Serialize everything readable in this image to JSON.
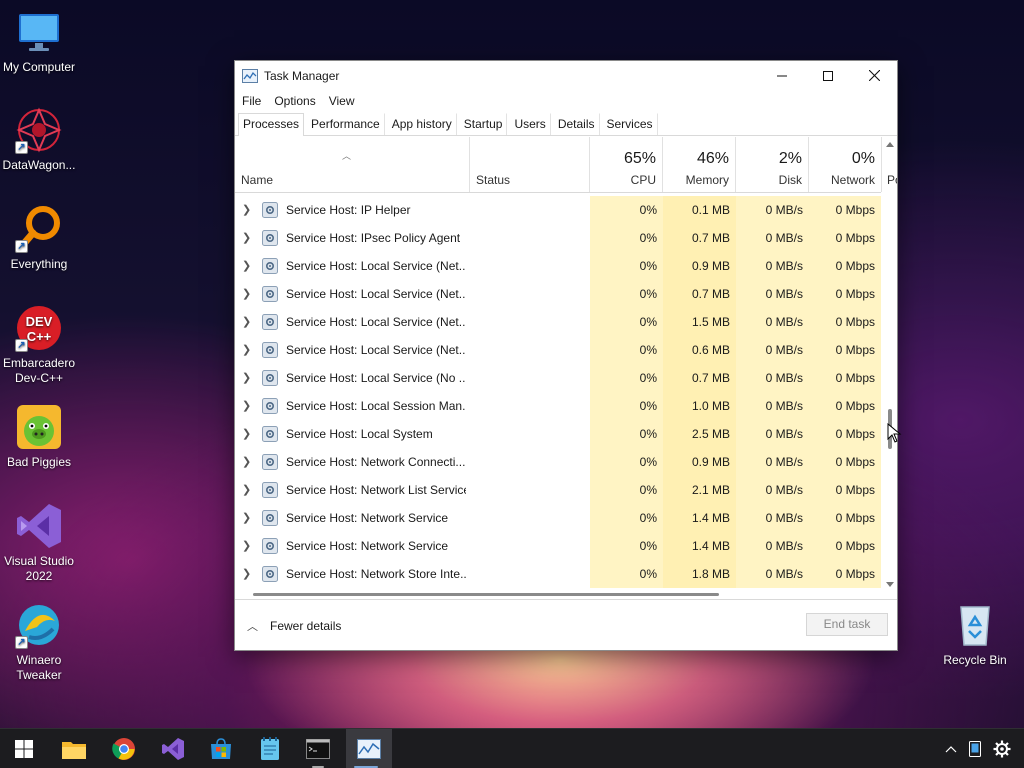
{
  "desktop": {
    "icons": [
      {
        "label": "My Computer"
      },
      {
        "label": "DataWagon..."
      },
      {
        "label": "Everything"
      },
      {
        "label": "Embarcadero Dev-C++"
      },
      {
        "label": "Bad Piggies"
      },
      {
        "label": "Visual Studio 2022"
      },
      {
        "label": "Winaero Tweaker"
      },
      {
        "label": "Recycle Bin"
      }
    ]
  },
  "window": {
    "title": "Task Manager",
    "menu": [
      "File",
      "Options",
      "View"
    ],
    "tabs": [
      "Processes",
      "Performance",
      "App history",
      "Startup",
      "Users",
      "Details",
      "Services"
    ],
    "active_tab": "Processes",
    "columns": {
      "name": "Name",
      "status": "Status",
      "cpu": {
        "label": "CPU",
        "pct": "65%"
      },
      "memory": {
        "label": "Memory",
        "pct": "46%"
      },
      "disk": {
        "label": "Disk",
        "pct": "2%"
      },
      "network": {
        "label": "Network",
        "pct": "0%"
      },
      "power_partial": "Po"
    },
    "rows": [
      {
        "name": "Service Host: IP Helper",
        "cpu": "0%",
        "mem": "0.1 MB",
        "disk": "0 MB/s",
        "net": "0 Mbps"
      },
      {
        "name": "Service Host: IPsec Policy Agent",
        "cpu": "0%",
        "mem": "0.7 MB",
        "disk": "0 MB/s",
        "net": "0 Mbps"
      },
      {
        "name": "Service Host: Local Service (Net...",
        "cpu": "0%",
        "mem": "0.9 MB",
        "disk": "0 MB/s",
        "net": "0 Mbps"
      },
      {
        "name": "Service Host: Local Service (Net...",
        "cpu": "0%",
        "mem": "0.7 MB",
        "disk": "0 MB/s",
        "net": "0 Mbps"
      },
      {
        "name": "Service Host: Local Service (Net...",
        "cpu": "0%",
        "mem": "1.5 MB",
        "disk": "0 MB/s",
        "net": "0 Mbps"
      },
      {
        "name": "Service Host: Local Service (Net...",
        "cpu": "0%",
        "mem": "0.6 MB",
        "disk": "0 MB/s",
        "net": "0 Mbps"
      },
      {
        "name": "Service Host: Local Service (No ...",
        "cpu": "0%",
        "mem": "0.7 MB",
        "disk": "0 MB/s",
        "net": "0 Mbps"
      },
      {
        "name": "Service Host: Local Session Man...",
        "cpu": "0%",
        "mem": "1.0 MB",
        "disk": "0 MB/s",
        "net": "0 Mbps"
      },
      {
        "name": "Service Host: Local System",
        "cpu": "0%",
        "mem": "2.5 MB",
        "disk": "0 MB/s",
        "net": "0 Mbps"
      },
      {
        "name": "Service Host: Network Connecti...",
        "cpu": "0%",
        "mem": "0.9 MB",
        "disk": "0 MB/s",
        "net": "0 Mbps"
      },
      {
        "name": "Service Host: Network List Service",
        "cpu": "0%",
        "mem": "2.1 MB",
        "disk": "0 MB/s",
        "net": "0 Mbps"
      },
      {
        "name": "Service Host: Network Service",
        "cpu": "0%",
        "mem": "1.4 MB",
        "disk": "0 MB/s",
        "net": "0 Mbps"
      },
      {
        "name": "Service Host: Network Service",
        "cpu": "0%",
        "mem": "1.4 MB",
        "disk": "0 MB/s",
        "net": "0 Mbps"
      },
      {
        "name": "Service Host: Network Store Inte...",
        "cpu": "0%",
        "mem": "1.8 MB",
        "disk": "0 MB/s",
        "net": "0 Mbps"
      }
    ],
    "footer": {
      "fewer_details": "Fewer details",
      "end_task": "End task"
    }
  },
  "taskbar": {
    "items": [
      "start-icon",
      "file-explorer-icon",
      "chrome-icon",
      "visual-studio-icon",
      "microsoft-store-icon",
      "notepad-icon",
      "terminal-icon",
      "task-manager-icon"
    ],
    "tray": [
      "chevron-up-icon",
      "tablet-icon",
      "gear-icon"
    ]
  },
  "colors": {
    "cpu_heat": "#fff4c4",
    "memory_heat": "#fff0b3",
    "taskbar": "#1c1c1f"
  }
}
